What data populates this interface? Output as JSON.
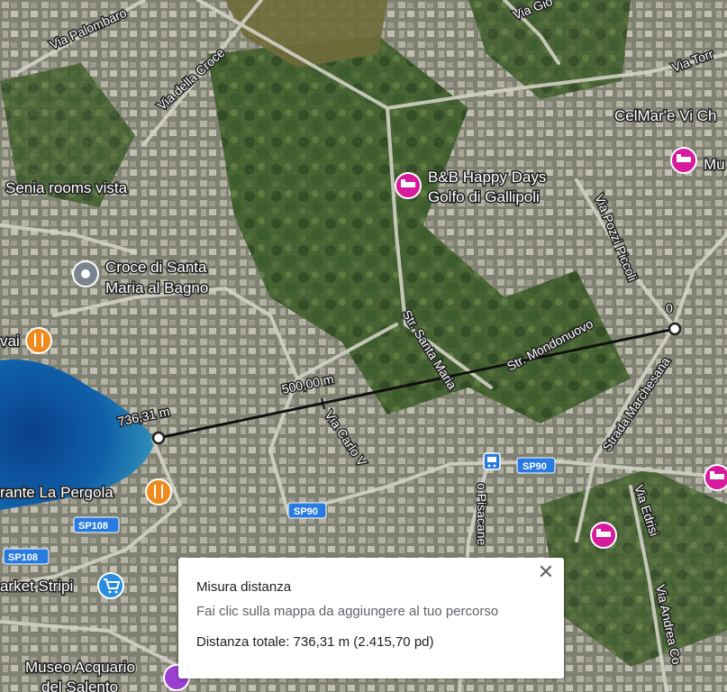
{
  "map": {
    "labels": {
      "via_palombaro": "Via Palombaro",
      "via_della_croce": "Via della Croce",
      "via_gio": "Via Gio",
      "via_torr": "Via Torr",
      "celmare": "CelMar'e Vi Ch",
      "senia": "Senia rooms vista",
      "bb_line1": "B&B Happy Days",
      "bb_line2": "Golfo di Gallipoli",
      "mu": "Mu",
      "via_pozzi_piccoli": "Via Pozzi Piccoli",
      "croce_line1": "Croce di Santa",
      "croce_line2": "Maria al Bagno",
      "vai": "vai",
      "str_santa_maria": "Str. Santa Maria",
      "str_mondonuovo": "Str. Mondonuovo",
      "strada_marchesana": "Strada Marchesana",
      "via_carlo_v": "Via Carlo V",
      "pergola": "rante La Pergola",
      "pisacane": "o Pisacane",
      "via_edrisi": "Via Edrisi",
      "via_andrea": "Via Andrea Co",
      "market": "arket Stripi",
      "museo_line1": "Museo Acquario",
      "museo_line2": "del Salento"
    },
    "roads": {
      "sp90_a": "SP90",
      "sp90_b": "SP90",
      "sp108_a": "SP108",
      "sp108_b": "SP108"
    },
    "measure": {
      "start_label": "0",
      "mid_label": "500,00 m",
      "end_label": "736,31 m"
    }
  },
  "panel": {
    "title": "Misura distanza",
    "hint": "Fai clic sulla mappa da aggiungere al tuo percorso",
    "total": "Distanza totale: 736,31 m (2.415,70 pd)",
    "close_glyph": "✕"
  },
  "colors": {
    "water": "#0d4f9e",
    "vegetation": "#3f5a2c",
    "urban": "#8a8a7c",
    "road": "#cfcfc6",
    "lodging_pin": "#d81b9c",
    "food_pin": "#f08a1c",
    "shop_pin": "#2a8de0",
    "road_badge": "#2a7be0"
  },
  "icons": {
    "lodging": "bed-icon",
    "food": "fork-knife-icon",
    "shop": "cart-icon",
    "transit": "bus-icon",
    "landmark": "landmark-dot-icon",
    "close": "close-icon"
  }
}
